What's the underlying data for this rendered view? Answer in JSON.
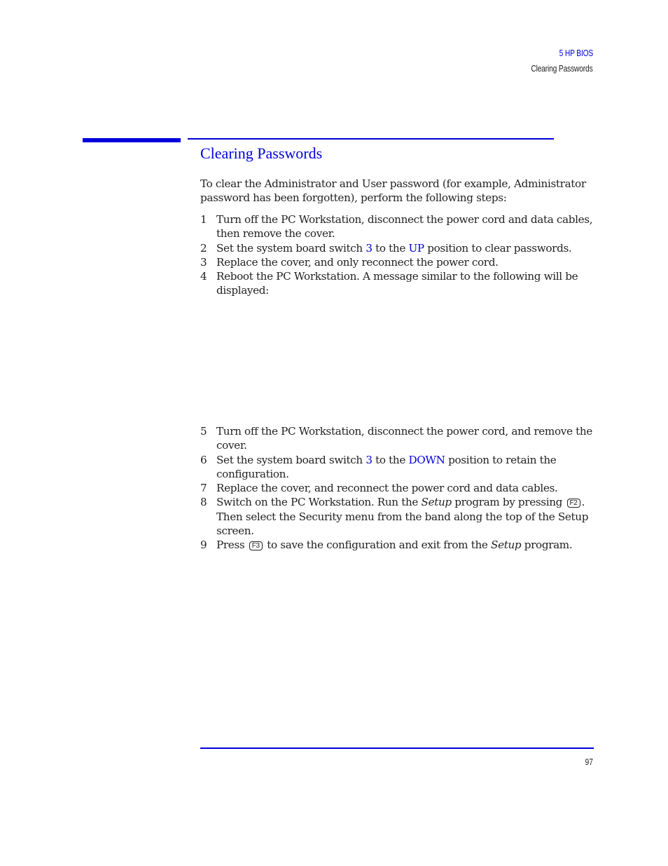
{
  "header": {
    "chapter": "5   HP BIOS",
    "section": "Clearing Passwords"
  },
  "title": "Clearing Passwords",
  "intro": "To clear the Administrator and User password (for example, Administrator password has been forgotten), perform the following steps:",
  "steps": [
    {
      "num": "1",
      "text": "Turn off the PC Workstation, disconnect the power cord and data cables, then remove the cover."
    },
    {
      "num": "2",
      "a": "Set the system board switch ",
      "switch": "3",
      "b": " to the ",
      "pos": "UP",
      "c": " position to clear passwords."
    },
    {
      "num": "3",
      "text": "Replace the cover, and only reconnect the power cord."
    },
    {
      "num": "4",
      "text": "Reboot the PC Workstation. A message similar to the following will be displayed:"
    },
    {
      "num": "5",
      "text": "Turn off the PC Workstation, disconnect the power cord, and remove the cover."
    },
    {
      "num": "6",
      "a": "Set the system board switch ",
      "switch": "3",
      "b": " to the ",
      "pos": "DOWN",
      "c": " position to retain the configuration."
    },
    {
      "num": "7",
      "text": "Replace the cover, and reconnect the power cord and data cables."
    },
    {
      "num": "8",
      "a": "Switch on the PC Workstation. Run the ",
      "em": "Setup",
      "b": " program by pressing ",
      "key": "F2",
      "c": ". Then select the Security menu from the band along the top of the Setup screen."
    },
    {
      "num": "9",
      "a": "Press ",
      "key": "F3",
      "b": " to save the configuration and exit from the ",
      "em": "Setup",
      "c": " program."
    }
  ],
  "footer": {
    "page_number": "97"
  }
}
